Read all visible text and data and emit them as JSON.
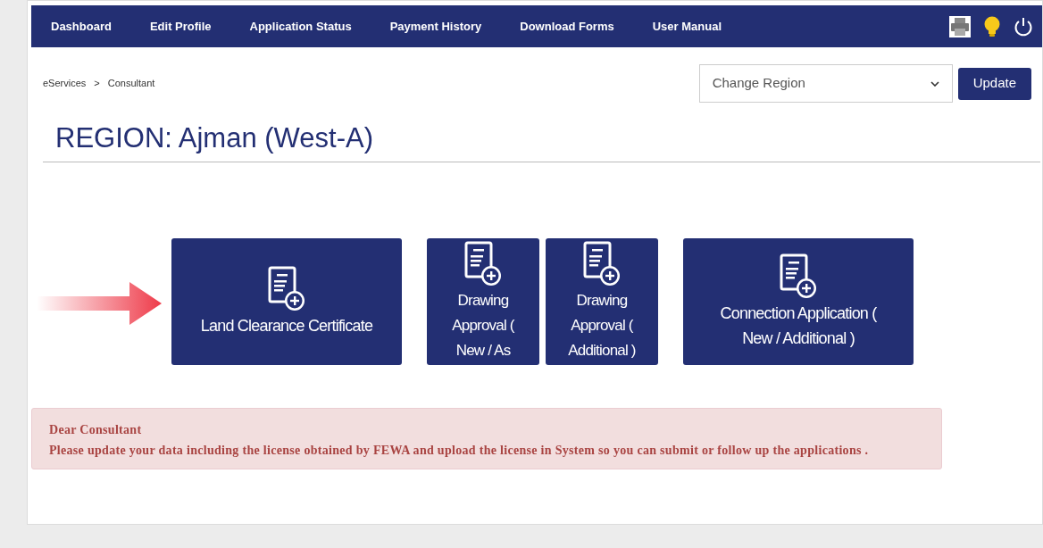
{
  "nav": {
    "items": [
      "Dashboard",
      "Edit Profile",
      "Application Status",
      "Payment History",
      "Download Forms",
      "User Manual"
    ]
  },
  "breadcrumb": {
    "items": [
      "eServices",
      "Consultant"
    ],
    "separator": ">"
  },
  "region_select": {
    "placeholder": "Change Region"
  },
  "update_button": "Update",
  "heading": "REGION: Ajman (West-A)",
  "tiles": [
    {
      "label": "Land Clearance Certificate",
      "kind": "wide"
    },
    {
      "label": "Drawing Approval ( New / As",
      "kind": "narrow"
    },
    {
      "label": "Drawing Approval ( Additional )",
      "kind": "narrow"
    },
    {
      "label": "Connection Application ( New / Additional )",
      "kind": "wide"
    }
  ],
  "alert": {
    "title": "Dear Consultant",
    "message": "Please update your data including the license obtained by FEWA and upload the license in System so you can submit or follow up the applications ."
  }
}
